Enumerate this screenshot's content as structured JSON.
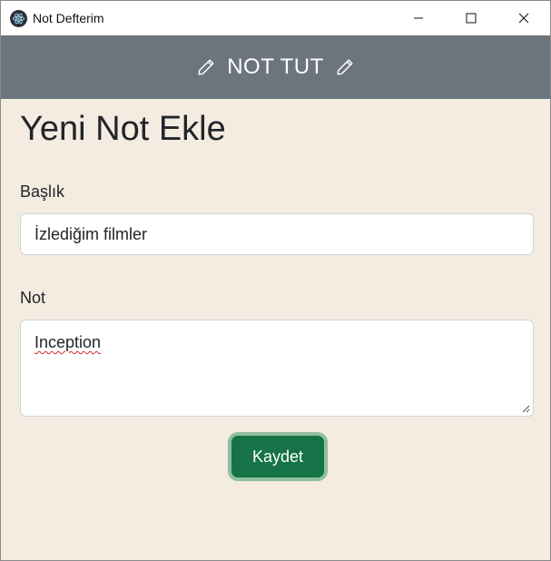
{
  "window": {
    "title": "Not Defterim",
    "app_icon": "electron-atom-icon"
  },
  "header": {
    "title": "NOT TUT",
    "left_icon": "pencil-icon",
    "right_icon": "pencil-icon",
    "background": "#6c757d"
  },
  "page": {
    "title": "Yeni Not Ekle",
    "background": "#f4ebe1"
  },
  "form": {
    "title_label": "Başlık",
    "title_value": "İzlediğim filmler",
    "note_label": "Not",
    "note_value": "Inception",
    "save_label": "Kaydet",
    "save_color": "#157347"
  }
}
